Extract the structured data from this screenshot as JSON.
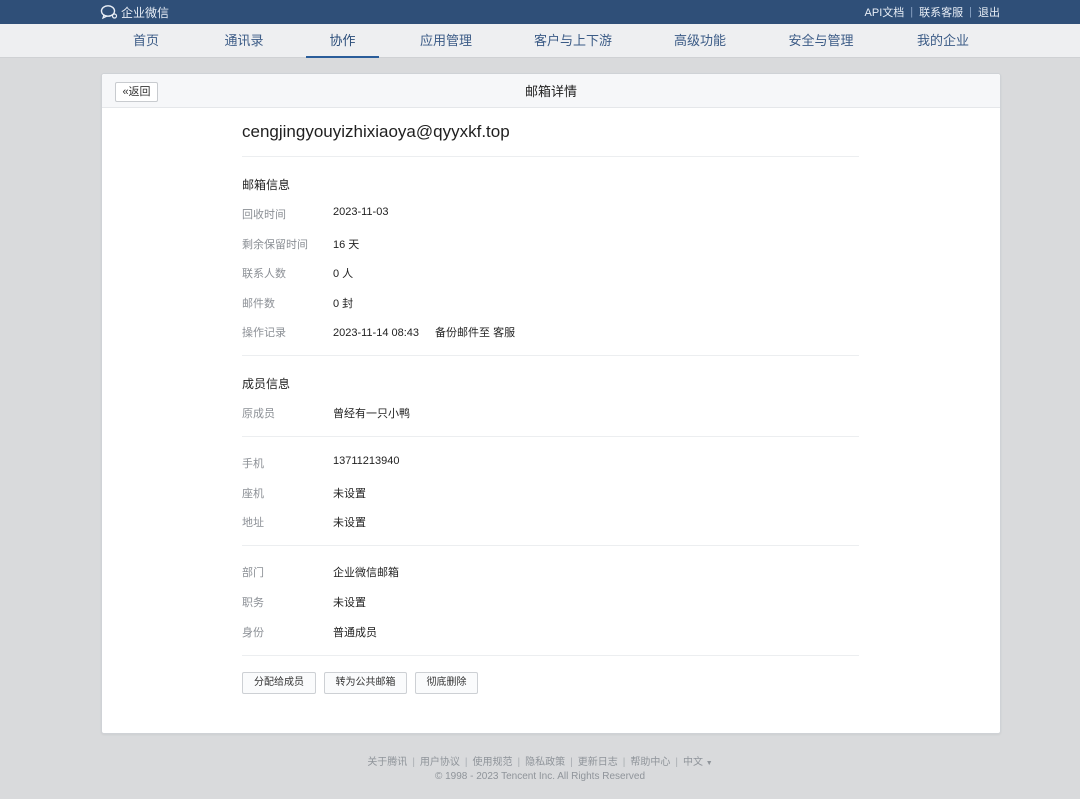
{
  "topbar": {
    "logo_text": "企业微信",
    "links": [
      "API文档",
      "联系客服",
      "退出"
    ]
  },
  "nav": {
    "items": [
      "首页",
      "通讯录",
      "协作",
      "应用管理",
      "客户与上下游",
      "高级功能",
      "安全与管理",
      "我的企业"
    ],
    "active": "协作"
  },
  "card": {
    "back_label": "«返回",
    "title": "邮箱详情",
    "email": "cengjingyouyizhixiaoya@qyyxkf.top"
  },
  "mailbox_info": {
    "title": "邮箱信息",
    "rows": [
      {
        "label": "回收时间",
        "value": "2023-11-03"
      },
      {
        "label": "剩余保留时间",
        "value": "16 天"
      },
      {
        "label": "联系人数",
        "value": "0 人"
      },
      {
        "label": "邮件数",
        "value": "0 封"
      },
      {
        "label": "操作记录",
        "value": "2023-11-14 08:43",
        "extra": "备份邮件至 客服"
      }
    ]
  },
  "member_info": {
    "title": "成员信息",
    "original": {
      "label": "原成员",
      "value": "曾经有一只小鸭"
    },
    "contact": [
      {
        "label": "手机",
        "value": "13711213940"
      },
      {
        "label": "座机",
        "value": "未设置"
      },
      {
        "label": "地址",
        "value": "未设置"
      }
    ],
    "org": [
      {
        "label": "部门",
        "value": "企业微信邮箱"
      },
      {
        "label": "职务",
        "value": "未设置"
      },
      {
        "label": "身份",
        "value": "普通成员"
      }
    ]
  },
  "actions": {
    "assign": "分配给成员",
    "convert": "转为公共邮箱",
    "delete": "彻底删除"
  },
  "footer": {
    "links": [
      "关于腾讯",
      "用户协议",
      "使用规范",
      "隐私政策",
      "更新日志",
      "帮助中心"
    ],
    "language": "中文",
    "language_caret": "▼",
    "copyright": "© 1998 - 2023 Tencent Inc. All Rights Reserved"
  }
}
